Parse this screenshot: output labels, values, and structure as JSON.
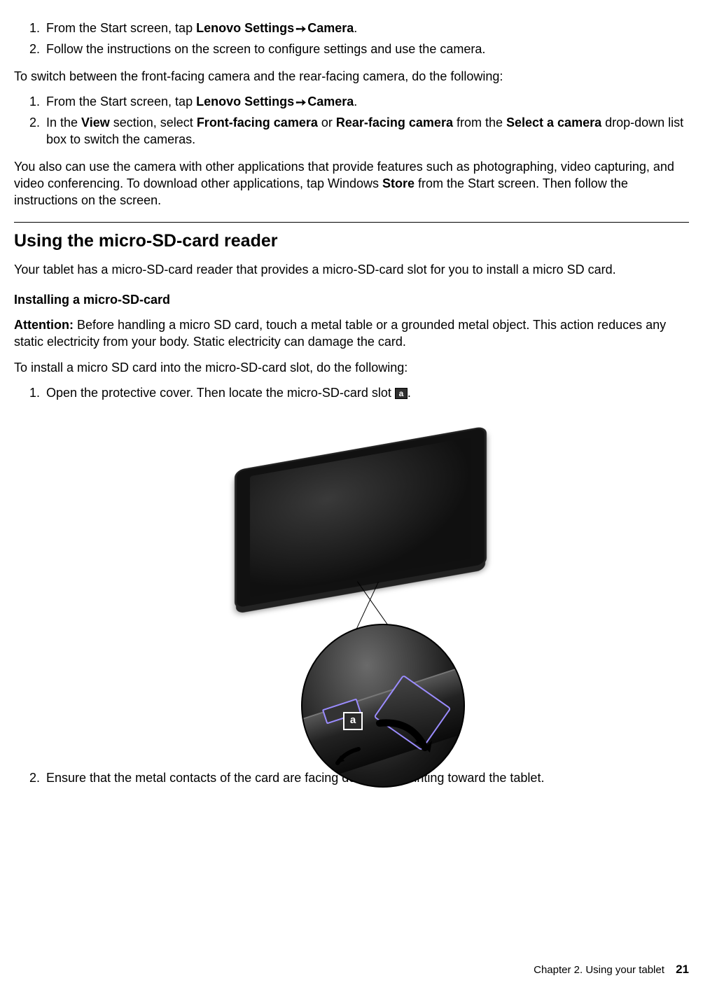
{
  "list1": {
    "item1_pre": "From the Start screen, tap ",
    "item1_b1": "Lenovo Settings",
    "item1_b2": "Camera",
    "item1_post": ".",
    "item2": "Follow the instructions on the screen to configure settings and use the camera."
  },
  "para1": "To switch between the front-facing camera and the rear-facing camera, do the following:",
  "list2": {
    "item1_pre": "From the Start screen, tap ",
    "item1_b1": "Lenovo Settings",
    "item1_b2": "Camera",
    "item1_post": ".",
    "item2_a": "In the ",
    "item2_b1": "View",
    "item2_b": " section, select ",
    "item2_b2": "Front-facing camera",
    "item2_c": " or ",
    "item2_b3": "Rear-facing camera",
    "item2_d": " from the ",
    "item2_b4": "Select a camera",
    "item2_e": " drop-down list box to switch the cameras."
  },
  "para2_a": "You also can use the camera with other applications that provide features such as photographing, video capturing, and video conferencing. To download other applications, tap Windows ",
  "para2_b": "Store",
  "para2_c": " from the Start screen. Then follow the instructions on the screen.",
  "heading": "Using the micro-SD-card reader",
  "para3": "Your tablet has a micro-SD-card reader that provides a micro-SD-card slot for you to install a micro SD card.",
  "subheading": "Installing a micro-SD-card",
  "attention_label": "Attention:",
  "attention_text": " Before handling a micro SD card, touch a metal table or a grounded metal object. This action reduces any static electricity from your body. Static electricity can damage the card.",
  "para4": "To install a micro SD card into the micro-SD-card slot, do the following:",
  "list3": {
    "item1": "Open the protective cover. Then locate the micro-SD-card slot ",
    "item2": "Ensure that the metal contacts of the card are facing down and pointing toward the tablet."
  },
  "callout": "a",
  "mag_label": "a",
  "footer_chapter": "Chapter 2.  Using your tablet",
  "footer_page": "21"
}
